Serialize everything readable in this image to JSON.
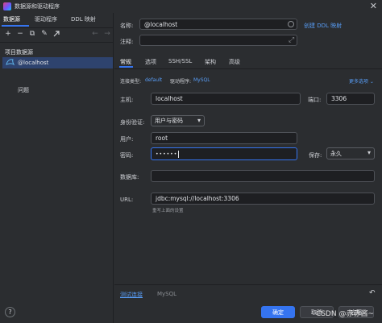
{
  "window": {
    "title": "数据源和驱动程序",
    "close_glyph": "✕"
  },
  "left": {
    "tabs": [
      "数据源",
      "驱动程序",
      "DDL 映射"
    ],
    "toolbar": {
      "add": "+",
      "remove": "−",
      "copy": "⧉",
      "settings": "✎",
      "back": "←",
      "forward": "→"
    },
    "section_label": "项目数据源",
    "tree_item": "@localhost",
    "problems": "问题",
    "help": "?"
  },
  "form": {
    "name_label": "名称:",
    "name_value": "@localhost",
    "create_ddl_link": "创建 DDL 映射",
    "comment_label": "注释:",
    "tabs": [
      "常规",
      "选项",
      "SSH/SSL",
      "架构",
      "高级"
    ],
    "conn_type_label": "连接类型:",
    "conn_type_value": "default",
    "driver_label": "驱动程序:",
    "driver_value": "MySQL",
    "more_options": "更多选项 ⌄",
    "host_label": "主机:",
    "host_value": "localhost",
    "port_label": "端口:",
    "port_value": "3306",
    "auth_label": "身份验证:",
    "auth_value": "用户与密码",
    "user_label": "用户:",
    "user_value": "root",
    "password_label": "密码:",
    "password_value": "••••••",
    "save_label": "保存:",
    "save_value": "永久",
    "database_label": "数据库:",
    "database_value": "",
    "url_label": "URL:",
    "url_value": "jdbc:mysql://localhost:3306",
    "url_hint": "重写上面的设置",
    "test_connection": "测试连接",
    "test_driver": "MySQL",
    "ok_button": "确定",
    "cancel_button": "取消",
    "apply_button": "应用"
  },
  "watermark": "CSDN @赤赤酱~"
}
